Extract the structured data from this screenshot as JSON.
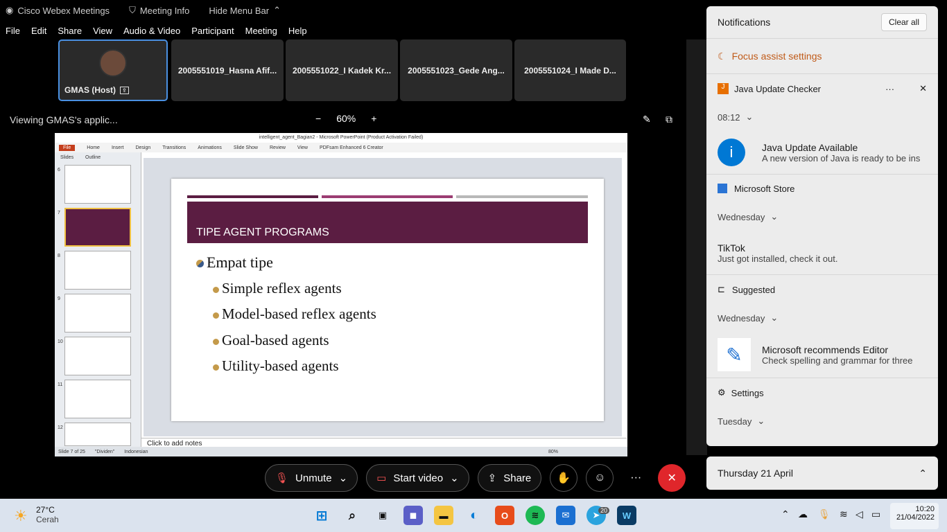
{
  "webex": {
    "app_title": "Cisco Webex Meetings",
    "meeting_info": "Meeting Info",
    "hide_menu": "Hide Menu Bar",
    "menu": [
      "File",
      "Edit",
      "Share",
      "View",
      "Audio & Video",
      "Participant",
      "Meeting",
      "Help"
    ],
    "participants": [
      {
        "name": "GMAS (Host)"
      },
      {
        "name": "2005551019_Hasna Afif..."
      },
      {
        "name": "2005551022_I Kadek Kr..."
      },
      {
        "name": "2005551023_Gede Ang..."
      },
      {
        "name": "2005551024_I Made D..."
      }
    ],
    "viewing": "Viewing GMAS's applic...",
    "zoom": "60%",
    "controls": {
      "unmute": "Unmute",
      "start_video": "Start video",
      "share": "Share"
    }
  },
  "ppt": {
    "title": "intelligent_agent_Bagian2 - Microsoft PowerPoint (Product Activation Failed)",
    "ribbon": [
      "File",
      "Home",
      "Insert",
      "Design",
      "Transitions",
      "Animations",
      "Slide Show",
      "Review",
      "View",
      "PDFsam Enhanced 6 Creator"
    ],
    "tabs": [
      "Slides",
      "Outline"
    ],
    "thumb_numbers": [
      "6",
      "7",
      "8",
      "9",
      "10",
      "11",
      "12"
    ],
    "slide": {
      "heading": "TIPE AGENT PROGRAMS",
      "main_bullet": "Empat tipe",
      "sub_bullets": [
        "Simple reflex agents",
        "Model-based reflex agents",
        "Goal-based agents",
        "Utility-based agents"
      ]
    },
    "notes": "Click to add notes",
    "status": {
      "slide": "Slide 7 of 25",
      "theme": "\"Dividen\"",
      "lang": "Indonesian",
      "zoom": "80%"
    }
  },
  "notifications": {
    "title": "Notifications",
    "clear_all": "Clear all",
    "focus_assist": "Focus assist settings",
    "java": {
      "app": "Java Update Checker",
      "time": "08:12",
      "heading": "Java Update Available",
      "body": "A new version of Java is ready to be ins"
    },
    "store": {
      "app": "Microsoft Store",
      "day": "Wednesday",
      "heading": "TikTok",
      "body": "Just got installed, check it out."
    },
    "suggested": {
      "app": "Suggested",
      "day": "Wednesday",
      "heading": "Microsoft recommends Editor",
      "body": "Check spelling and grammar for three"
    },
    "settings": {
      "app": "Settings",
      "day": "Tuesday"
    },
    "date": "Thursday 21 April"
  },
  "taskbar": {
    "temp": "27°C",
    "weather": "Cerah",
    "time": "10:20",
    "date": "21/04/2022",
    "badge": "20"
  }
}
